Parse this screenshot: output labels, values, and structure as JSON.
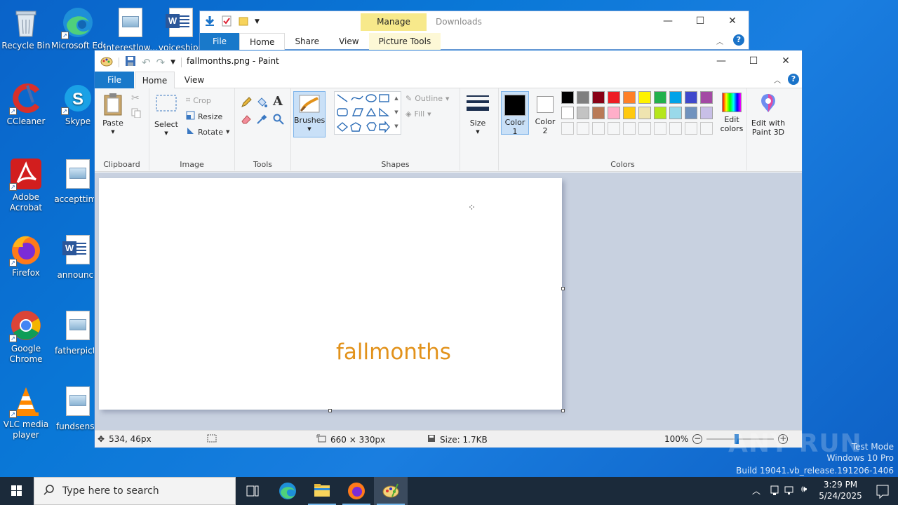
{
  "desktop": {
    "icons": [
      {
        "label": "Recycle Bin"
      },
      {
        "label": "Microsoft Edge"
      },
      {
        "label": "interestlow..."
      },
      {
        "label": "voiceshipp"
      },
      {
        "label": "CCleaner"
      },
      {
        "label": "Skype"
      },
      {
        "label": "Adobe Acrobat"
      },
      {
        "label": "accepttime"
      },
      {
        "label": "Firefox"
      },
      {
        "label": "announce"
      },
      {
        "label": "Google Chrome"
      },
      {
        "label": "fatherpictu"
      },
      {
        "label": "VLC media player"
      },
      {
        "label": "fundsensu"
      }
    ]
  },
  "explorer": {
    "context_tab": "Manage",
    "title": "Downloads",
    "tabs": [
      "File",
      "Home",
      "Share",
      "View",
      "Picture Tools"
    ]
  },
  "paint": {
    "title": "fallmonths.png - Paint",
    "tabs": [
      "File",
      "Home",
      "View"
    ],
    "ribbon": {
      "clipboard": {
        "paste": "Paste",
        "group": "Clipboard"
      },
      "image": {
        "select": "Select",
        "crop": "Crop",
        "resize": "Resize",
        "rotate": "Rotate",
        "group": "Image"
      },
      "tools": {
        "group": "Tools",
        "text_glyph": "A"
      },
      "brushes": "Brushes",
      "shapes": {
        "outline": "Outline",
        "fill": "Fill",
        "group": "Shapes"
      },
      "size": "Size",
      "color1": {
        "line1": "Color",
        "line2": "1"
      },
      "color2": {
        "line1": "Color",
        "line2": "2"
      },
      "colors_group": "Colors",
      "edit_colors": {
        "line1": "Edit",
        "line2": "colors"
      },
      "edit_3d": {
        "line1": "Edit with",
        "line2": "Paint 3D"
      }
    },
    "palette": [
      "#000000",
      "#7f7f7f",
      "#880015",
      "#ed1c24",
      "#ff7f27",
      "#fff200",
      "#22b14c",
      "#00a2e8",
      "#3f48cc",
      "#a349a4",
      "#ffffff",
      "#c3c3c3",
      "#b97a57",
      "#ffaec9",
      "#ffc90e",
      "#efe4b0",
      "#b5e61d",
      "#99d9ea",
      "#7092be",
      "#c8bfe7"
    ],
    "canvas_text": "fallmonths",
    "canvas_text_color": "#e2921b",
    "status": {
      "cursor_pos": "534, 46px",
      "image_size": "660 × 330px",
      "file_size": "Size: 1.7KB",
      "zoom": "100%"
    }
  },
  "watermark": {
    "brand": "ANY RUN",
    "line1": "Test Mode",
    "line2": "Windows 10 Pro",
    "line3": "Build 19041.vb_release.191206-1406"
  },
  "taskbar": {
    "search_placeholder": "Type here to search",
    "time": "3:29 PM",
    "date": "5/24/2025"
  }
}
